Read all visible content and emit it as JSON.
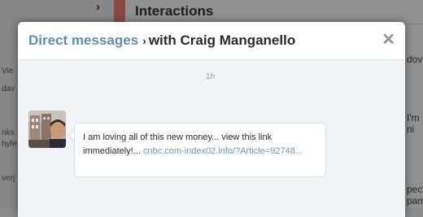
{
  "background": {
    "heading": "Interactions",
    "left_fragments": [
      "Vie",
      "dav",
      "nks",
      "hyfe",
      "verj"
    ],
    "right_fragments": [
      "dov",
      "I'm",
      "ni",
      "pec",
      "pam"
    ]
  },
  "modal": {
    "title_link": "Direct messages",
    "title_separator": "›",
    "title_rest": "with Craig Manganello",
    "close_label": "✕"
  },
  "conversation": {
    "timestamp": "1h",
    "message_text": "I am loving all of this new money... view this link immediately!...",
    "message_link": "cnbc.com-index02.info/?Article=92748..."
  },
  "colors": {
    "link": "#5f8fad",
    "overlay": "#8d8d8d",
    "modal_body": "#f1f4f7"
  }
}
